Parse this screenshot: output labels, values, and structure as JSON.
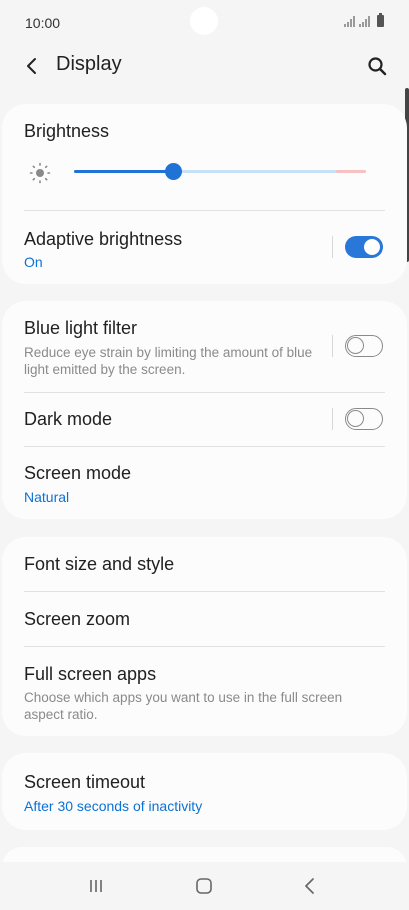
{
  "status_bar": {
    "time": "10:00"
  },
  "app_bar": {
    "title": "Display"
  },
  "brightness": {
    "title": "Brightness",
    "level_percent": 34
  },
  "adaptive_brightness": {
    "title": "Adaptive brightness",
    "status": "On",
    "enabled": true
  },
  "blue_light_filter": {
    "title": "Blue light filter",
    "description": "Reduce eye strain by limiting the amount of blue light emitted by the screen.",
    "enabled": false
  },
  "dark_mode": {
    "title": "Dark mode",
    "enabled": false
  },
  "screen_mode": {
    "title": "Screen mode",
    "value": "Natural"
  },
  "font_size_and_style": {
    "title": "Font size and style"
  },
  "screen_zoom": {
    "title": "Screen zoom"
  },
  "full_screen_apps": {
    "title": "Full screen apps",
    "description": "Choose which apps you want to use in the full screen aspect ratio."
  },
  "screen_timeout": {
    "title": "Screen timeout",
    "value": "After 30 seconds of inactivity"
  },
  "colors": {
    "accent": "#1f73d6",
    "link_text": "#0b72d6",
    "card_bg": "#fcfcfc",
    "page_bg": "#f5f5f5"
  },
  "icons": {
    "back": "chevron-left-icon",
    "search": "search-icon",
    "brightness": "sun-icon",
    "nav_recents": "recents-icon",
    "nav_home": "home-icon",
    "nav_back": "nav-back-icon"
  }
}
